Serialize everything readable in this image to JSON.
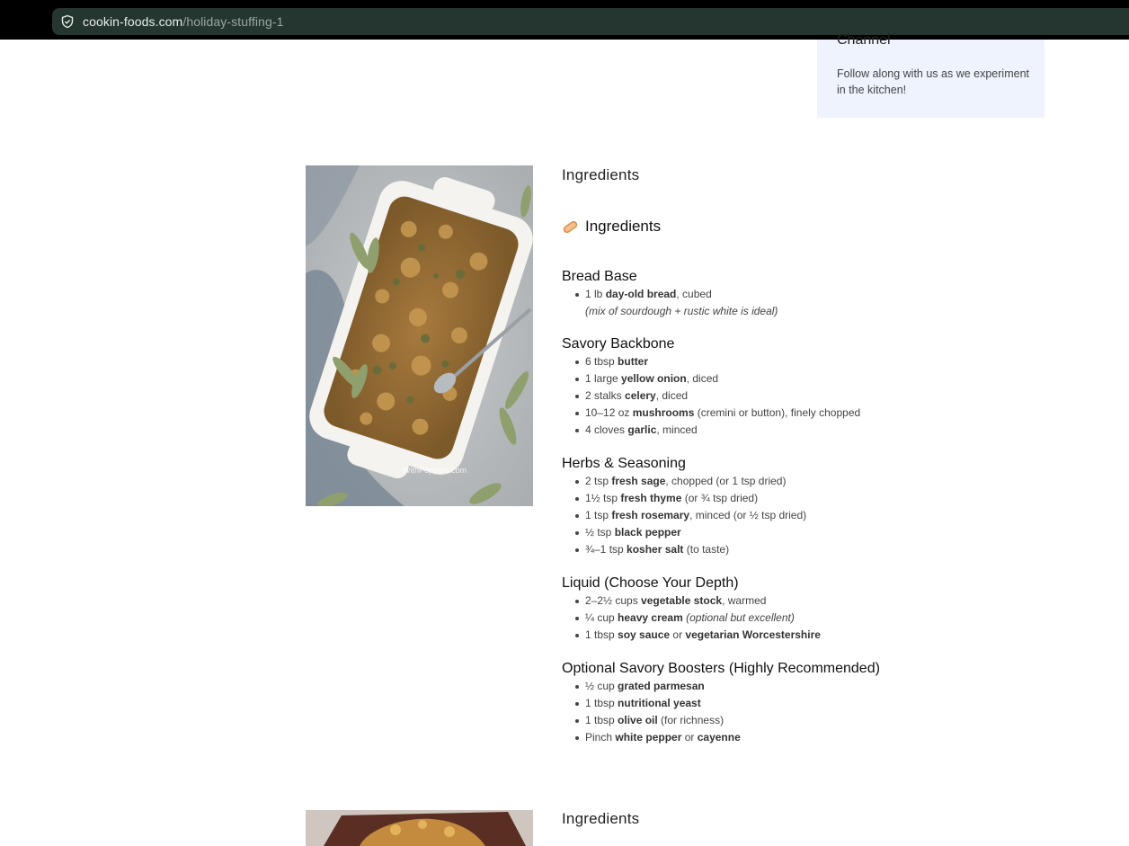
{
  "browser": {
    "url_domain": "cookin-foods.com",
    "url_path": "/holiday-stuffing-1",
    "shield_icon": "shield-check-icon"
  },
  "sidebar_card": {
    "title": "Channel",
    "text": "Follow along with us as we experiment in the kitchen!"
  },
  "recipe": {
    "section_label": "Ingredients",
    "heading": "Ingredients",
    "heading_icon": "bread-emoji-icon",
    "photo_watermark": "WithPeppers.com",
    "groups": [
      {
        "title": "Bread Base",
        "items": [
          {
            "pre": "1 lb ",
            "bold": "day-old bread",
            "post": ", cubed"
          }
        ],
        "note": "(mix of sourdough + rustic white is ideal)"
      },
      {
        "title": "Savory Backbone",
        "items": [
          {
            "pre": "6 tbsp ",
            "bold": "butter",
            "post": ""
          },
          {
            "pre": "1 large ",
            "bold": "yellow onion",
            "post": ", diced"
          },
          {
            "pre": "2 stalks ",
            "bold": "celery",
            "post": ", diced"
          },
          {
            "pre": "10–12 oz ",
            "bold": "mushrooms",
            "post": " (cremini or button), finely chopped"
          },
          {
            "pre": "4 cloves ",
            "bold": "garlic",
            "post": ", minced"
          }
        ]
      },
      {
        "title": "Herbs & Seasoning",
        "items": [
          {
            "pre": "2 tsp ",
            "bold": "fresh sage",
            "post": ", chopped (or 1 tsp dried)"
          },
          {
            "pre": "1½ tsp ",
            "bold": "fresh thyme",
            "post": " (or ¾ tsp dried)"
          },
          {
            "pre": "1 tsp ",
            "bold": "fresh rosemary",
            "post": ", minced (or ½ tsp dried)"
          },
          {
            "pre": "½ tsp ",
            "bold": "black pepper",
            "post": ""
          },
          {
            "pre": "¾–1 tsp ",
            "bold": "kosher salt",
            "post": " (to taste)"
          }
        ]
      },
      {
        "title": "Liquid (Choose Your Depth)",
        "items": [
          {
            "pre": "2–2½ cups ",
            "bold": "vegetable stock",
            "post": ", warmed"
          },
          {
            "pre": "¼ cup ",
            "bold": "heavy cream",
            "post": "",
            "italic": " (optional but excellent)"
          },
          {
            "pre": "1 tbsp ",
            "bold": "soy sauce",
            "post": " or ",
            "bold2": "vegetarian Worcestershire"
          }
        ]
      },
      {
        "title": "Optional Savory Boosters (Highly Recommended)",
        "items": [
          {
            "pre": "½ cup ",
            "bold": "grated parmesan",
            "post": ""
          },
          {
            "pre": "1 tbsp ",
            "bold": "nutritional yeast",
            "post": ""
          },
          {
            "pre": "1 tbsp ",
            "bold": "olive oil",
            "post": " (for richness)"
          },
          {
            "pre": "Pinch ",
            "bold": "white pepper",
            "post": " or ",
            "bold2": "cayenne"
          }
        ]
      }
    ],
    "next_section_label": "Ingredients"
  }
}
